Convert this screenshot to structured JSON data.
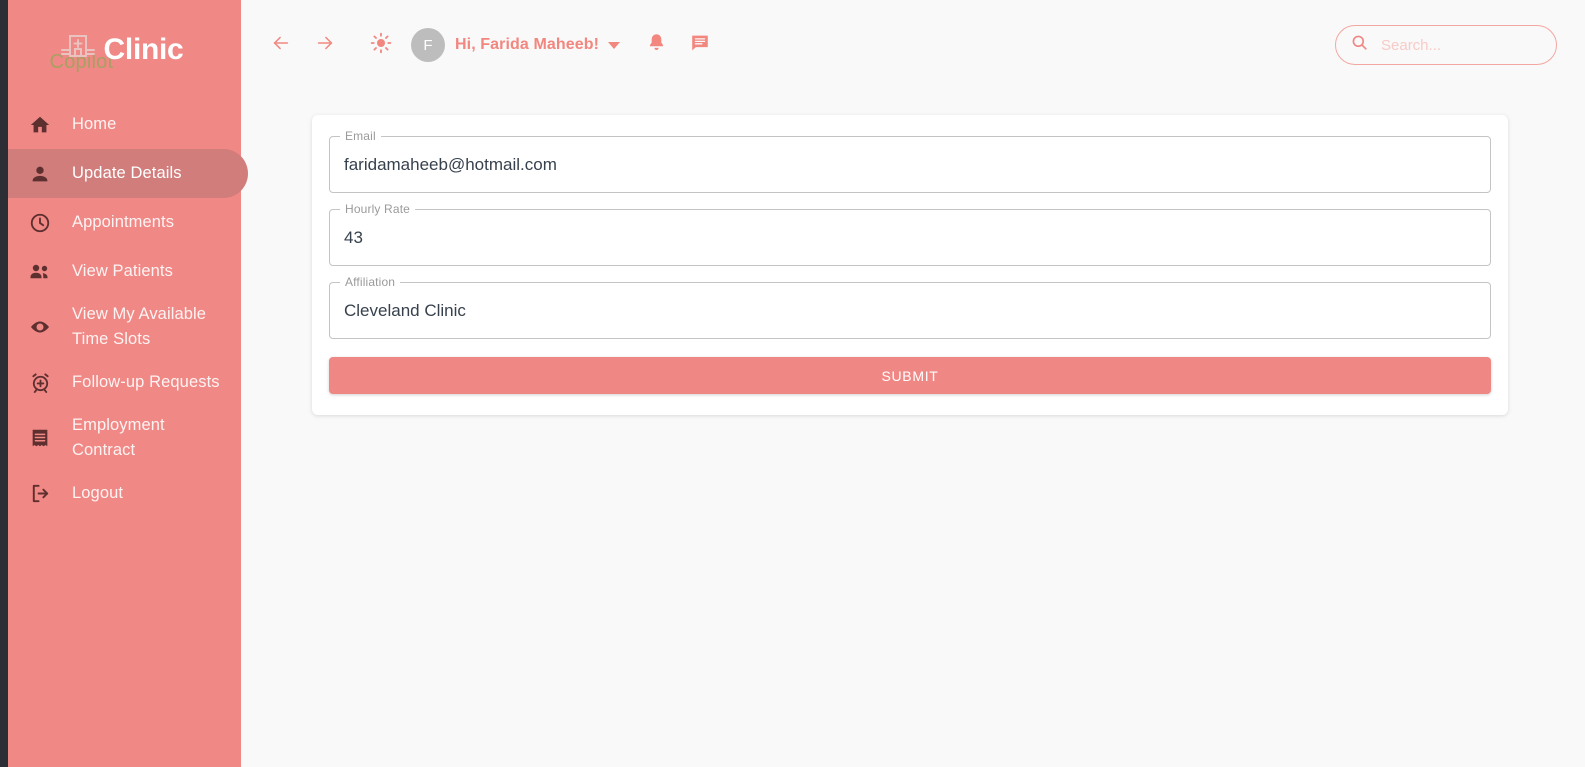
{
  "brand": {
    "copilot_text": "Copilot",
    "name": "Clinic",
    "icon": "hospital-icon"
  },
  "sidebar": {
    "background_color": "#f08886",
    "active_item_color": "#d17d7c",
    "items": [
      {
        "label": "Home",
        "icon": "home-icon",
        "active": false
      },
      {
        "label": "Update Details",
        "icon": "person-icon",
        "active": true
      },
      {
        "label": "Appointments",
        "icon": "clock-icon",
        "active": false
      },
      {
        "label": "View Patients",
        "icon": "people-icon",
        "active": false
      },
      {
        "label": "View My Available Time Slots",
        "icon": "eye-icon",
        "active": false
      },
      {
        "label": "Follow-up Requests",
        "icon": "alarm-plus-icon",
        "active": false
      },
      {
        "label": "Employment Contract",
        "icon": "receipt-icon",
        "active": false
      },
      {
        "label": "Logout",
        "icon": "logout-icon",
        "active": false
      }
    ]
  },
  "header": {
    "accent_color": "#f2877f",
    "back_icon": "arrow-left-icon",
    "forward_icon": "arrow-right-icon",
    "theme_icon": "sun-icon",
    "avatar_initial": "F",
    "greeting": "Hi, Farida Maheeb!",
    "notifications_icon": "bell-icon",
    "messages_icon": "message-icon",
    "search": {
      "icon": "search-icon",
      "placeholder": "Search...",
      "value": ""
    }
  },
  "form": {
    "fields": [
      {
        "label": "Email",
        "value": "faridamaheeb@hotmail.com"
      },
      {
        "label": "Hourly Rate",
        "value": "43"
      },
      {
        "label": "Affiliation",
        "value": "Cleveland Clinic"
      }
    ],
    "submit_label": "SUBMIT",
    "submit_color": "#ef8784"
  }
}
